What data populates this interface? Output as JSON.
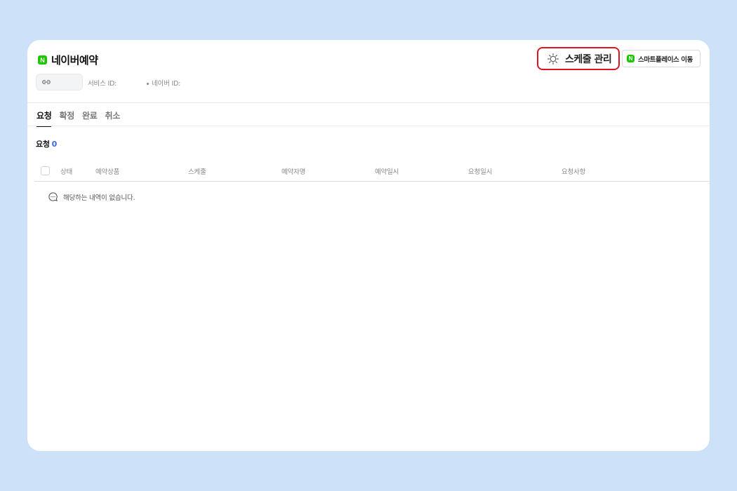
{
  "header": {
    "brand_logo_letter": "N",
    "brand_name": "네이버예약",
    "schedule_button_label": "스케줄 관리",
    "smartplace_logo_letter": "N",
    "smartplace_button_label": "스마트플레이스 이동",
    "service_id_label": "서비스 ID:",
    "naver_id_label": "네이버 ID:"
  },
  "tabs": [
    {
      "label": "요청",
      "active": true
    },
    {
      "label": "확정",
      "active": false
    },
    {
      "label": "완료",
      "active": false
    },
    {
      "label": "취소",
      "active": false
    }
  ],
  "section": {
    "title": "요청",
    "count": "0"
  },
  "table": {
    "columns": [
      "상태",
      "예약상품",
      "스케줄",
      "예약자명",
      "예약일시",
      "요청일시",
      "요청사항"
    ],
    "empty_message": "해당하는 내역이 없습니다."
  },
  "colors": {
    "background": "#cde1f8",
    "naver_green": "#1ec800",
    "highlight_red": "#e0141e",
    "count_blue": "#3b6be0"
  },
  "icons": {
    "schedule": "gear-icon",
    "link": "link-icon",
    "empty": "chat-bubble-icon"
  }
}
